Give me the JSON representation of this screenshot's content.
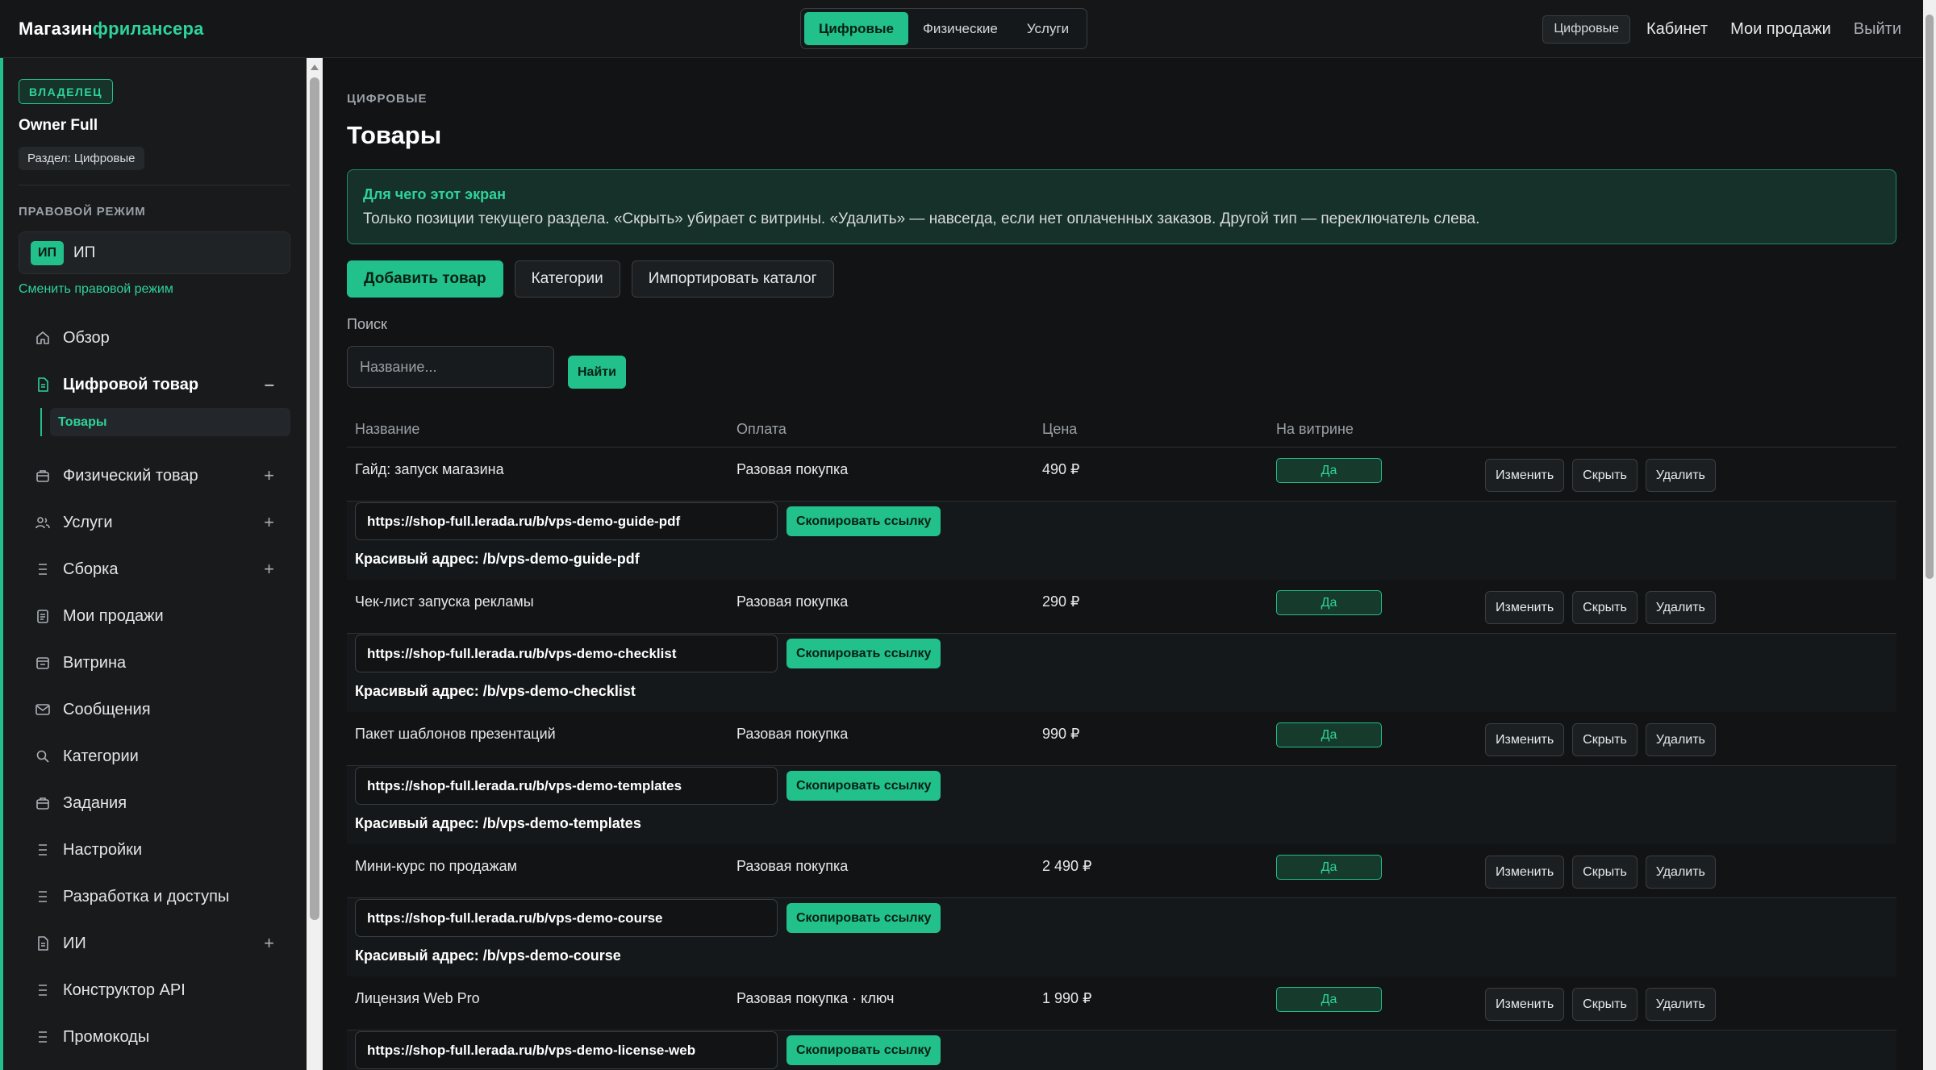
{
  "app": {
    "logo_part1": "Магазин",
    "logo_part2": "фрилансера"
  },
  "topbar": {
    "modes": [
      "Цифровые",
      "Физические",
      "Услуги"
    ],
    "active_mode": "Цифровые",
    "section_chip": "Цифровые",
    "links": [
      "Кабинет",
      "Мои продажи"
    ],
    "logout": "Выйти"
  },
  "sidebar": {
    "role_badge": "ВЛАДЕЛЕЦ",
    "owner_name": "Owner Full",
    "section_pill": "Раздел: Цифровые",
    "legal_caption": "ПРАВОВОЙ РЕЖИМ",
    "legal_chip": "ИП",
    "legal_name": "ИП",
    "change_legal": "Сменить правовой режим",
    "items": [
      {
        "label": "Обзор",
        "icon": "home-icon",
        "toggle": ""
      },
      {
        "label": "Цифровой товар",
        "icon": "document-icon",
        "toggle": "–",
        "active": true
      },
      {
        "label": "Физический товар",
        "icon": "briefcase-icon",
        "toggle": "+"
      },
      {
        "label": "Услуги",
        "icon": "users-icon",
        "toggle": "+"
      },
      {
        "label": "Сборка",
        "icon": "list-icon",
        "toggle": "+"
      },
      {
        "label": "Мои продажи",
        "icon": "clipboard-icon",
        "toggle": ""
      },
      {
        "label": "Витрина",
        "icon": "storefront-icon",
        "toggle": ""
      },
      {
        "label": "Сообщения",
        "icon": "mail-icon",
        "toggle": ""
      },
      {
        "label": "Категории",
        "icon": "search-icon",
        "toggle": ""
      },
      {
        "label": "Задания",
        "icon": "briefcase-icon",
        "toggle": ""
      },
      {
        "label": "Настройки",
        "icon": "list-icon",
        "toggle": ""
      },
      {
        "label": "Разработка и доступы",
        "icon": "list-icon",
        "toggle": ""
      },
      {
        "label": "ИИ",
        "icon": "document-icon",
        "toggle": "+"
      },
      {
        "label": "Конструктор API",
        "icon": "list-icon",
        "toggle": ""
      },
      {
        "label": "Промокоды",
        "icon": "list-icon",
        "toggle": ""
      }
    ],
    "sub_item": "Товары"
  },
  "main": {
    "crumb": "ЦИФРОВЫЕ",
    "title": "Товары",
    "info_title": "Для чего этот экран",
    "info_text": "Только позиции текущего раздела. «Скрыть» убирает с витрины. «Удалить» — навсегда, если нет оплаченных заказов. Другой тип — переключатель слева.",
    "buttons": {
      "add": "Добавить товар",
      "categories": "Категории",
      "import": "Импортировать каталог"
    },
    "search": {
      "label": "Поиск",
      "placeholder": "Название...",
      "button": "Найти"
    },
    "table": {
      "headers": [
        "Название",
        "Оплата",
        "Цена",
        "На витрине"
      ],
      "rows": [
        {
          "name": "Гайд: запуск магазина",
          "payment": "Разовая покупка",
          "price": "490 ₽",
          "visible": "Да",
          "link": "https://shop-full.lerada.ru/b/vps-demo-guide-pdf",
          "pretty": "Красивый адрес: /b/vps-demo-guide-pdf"
        },
        {
          "name": "Чек-лист запуска рекламы",
          "payment": "Разовая покупка",
          "price": "290 ₽",
          "visible": "Да",
          "link": "https://shop-full.lerada.ru/b/vps-demo-checklist",
          "pretty": "Красивый адрес: /b/vps-demo-checklist"
        },
        {
          "name": "Пакет шаблонов презентаций",
          "payment": "Разовая покупка",
          "price": "990 ₽",
          "visible": "Да",
          "link": "https://shop-full.lerada.ru/b/vps-demo-templates",
          "pretty": "Красивый адрес: /b/vps-demo-templates"
        },
        {
          "name": "Мини-курс по продажам",
          "payment": "Разовая покупка",
          "price": "2 490 ₽",
          "visible": "Да",
          "link": "https://shop-full.lerada.ru/b/vps-demo-course",
          "pretty": "Красивый адрес: /b/vps-demo-course"
        },
        {
          "name": "Лицензия Web Pro",
          "payment": "Разовая покупка · ключ",
          "price": "1 990 ₽",
          "visible": "Да",
          "link": "https://shop-full.lerada.ru/b/vps-demo-license-web",
          "pretty": ""
        }
      ],
      "row_actions": [
        "Изменить",
        "Скрыть",
        "Удалить"
      ],
      "copy_label": "Скопировать ссылку"
    }
  },
  "colors": {
    "accent": "#22c08a",
    "background": "#111315",
    "sidebar": "#181a1c"
  }
}
